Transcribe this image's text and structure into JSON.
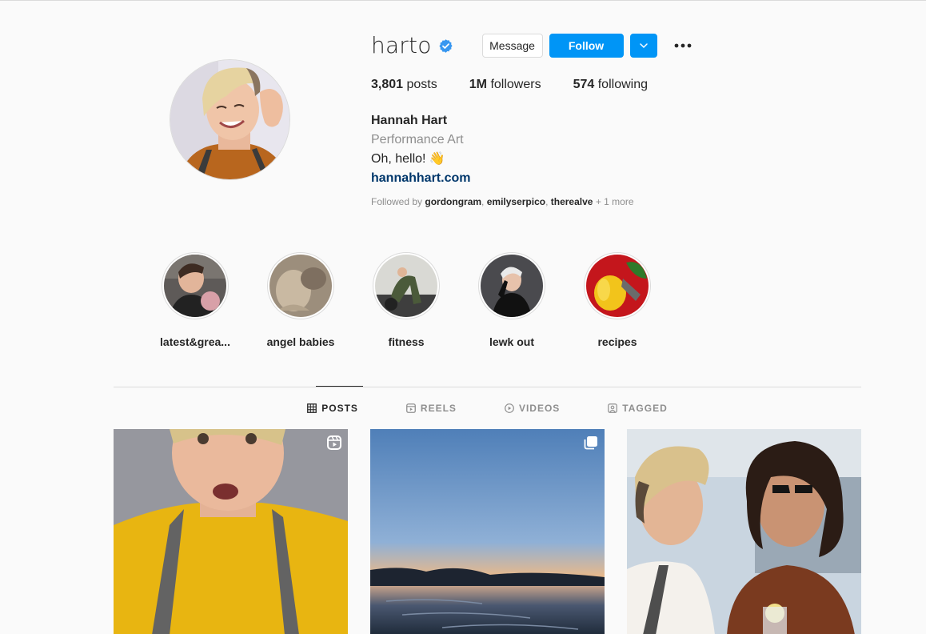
{
  "profile": {
    "username": "harto",
    "verified": true,
    "message_label": "Message",
    "follow_label": "Follow",
    "stats": {
      "posts_count": "3,801",
      "posts_label": "posts",
      "followers_count": "1M",
      "followers_label": "followers",
      "following_count": "574",
      "following_label": "following"
    },
    "bio": {
      "name": "Hannah Hart",
      "category": "Performance Art",
      "text": "Oh, hello! 👋",
      "link": "hannahhart.com"
    },
    "followed_by": {
      "prefix": "Followed by",
      "users": [
        "gordongram",
        "emilyserpico",
        "therealve"
      ],
      "more": "+ 1 more"
    }
  },
  "highlights": [
    {
      "label": "latest&grea..."
    },
    {
      "label": "angel babies"
    },
    {
      "label": "fitness"
    },
    {
      "label": "lewk out"
    },
    {
      "label": "recipes"
    }
  ],
  "tabs": [
    {
      "label": "POSTS",
      "icon": "grid-icon",
      "active": true
    },
    {
      "label": "REELS",
      "icon": "reels-icon",
      "active": false
    },
    {
      "label": "VIDEOS",
      "icon": "play-circle-icon",
      "active": false
    },
    {
      "label": "TAGGED",
      "icon": "tag-user-icon",
      "active": false
    }
  ],
  "posts": [
    {
      "badge": "reels-icon"
    },
    {
      "badge": "carousel-icon"
    },
    {
      "badge": null
    }
  ],
  "colors": {
    "accent": "#0095f6",
    "verified": "#3897f0",
    "link": "#00376b",
    "secondary_text": "#8e8e8e",
    "border": "#dbdbdb"
  }
}
